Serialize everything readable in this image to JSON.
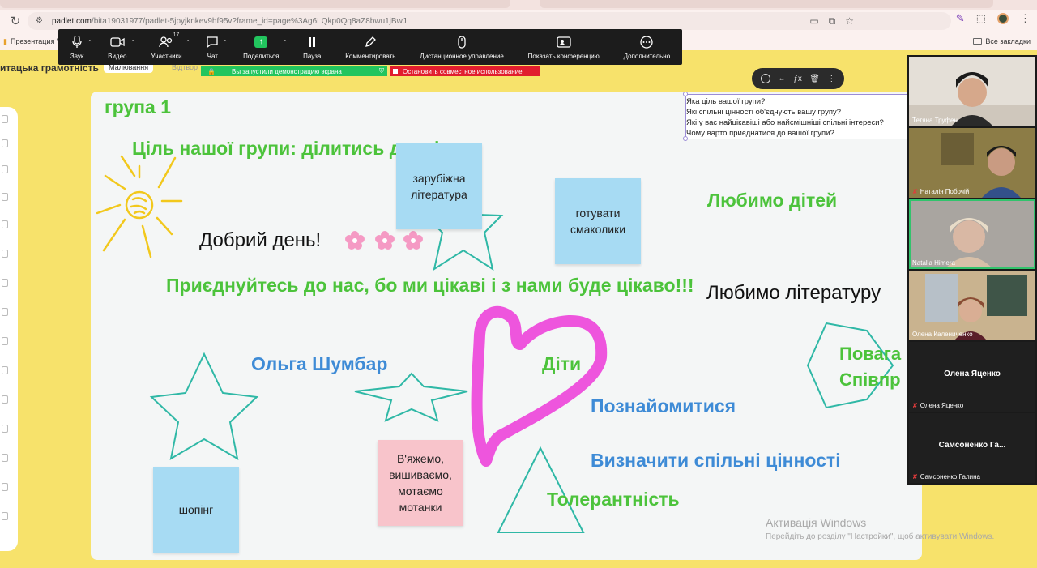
{
  "browser": {
    "url_domain": "padlet.com",
    "url_path": "/bita19031977/padlet-5jpyjknkev9hf95v?frame_id=page%3Ag6LQkp0Qq8aZ8bwu1jBwJ",
    "bookmark_left": "Презентация \"Г...",
    "bookmark_right": "Все закладки"
  },
  "padlet": {
    "title": "итацька грамотність",
    "mode_label": "Малювання",
    "mode_next": "Відтвор"
  },
  "zoom_toolbar": {
    "items": [
      {
        "label": "Звук"
      },
      {
        "label": "Видео"
      },
      {
        "label": "Участники",
        "badge": "17"
      },
      {
        "label": "Чат"
      },
      {
        "label": "Поделиться"
      },
      {
        "label": "Пауза"
      },
      {
        "label": "Комментировать"
      },
      {
        "label": "Дистанционное управление"
      },
      {
        "label": "Показать конференцию"
      },
      {
        "label": "Дополнительно"
      }
    ],
    "sharing_banner": "Вы запустили демонстрацию экрана",
    "stop_banner": "Остановить совместное использование"
  },
  "canvas": {
    "group_title": "група 1",
    "goal": "Ціль нашої групи: ділитись досвідом",
    "hello": "Добрий день!",
    "join": "Приєднуйтесь до нас, бо ми цікаві і з нами буде цікаво!!!",
    "love_kids": "Любимо дітей",
    "love_lit": "Любимо літературу",
    "olga": "Ольга Шумбар",
    "kids": "Діти",
    "meet": "Познайомитися",
    "values": "Визначити спільні цінності",
    "tolerance": "Толерантність",
    "respect_1": "Повага",
    "respect_2": "Співпр",
    "stickies": {
      "lit": "зарубіжна література",
      "cook": "готувати смаколики",
      "knit": "В'яжемо, вишиваємо, мотаємо мотанки",
      "shop": "шопінг"
    },
    "questions": [
      "Яка ціль вашої групи?",
      "Які спільні цінності об'єднують вашу групу?",
      "Які у вас найцікавіші або найсмішніші спільні інтереси?",
      "Чому варто приєднатися до вашої групи?"
    ],
    "colors": {
      "green": "#4cc33b",
      "blue": "#3e8bd6",
      "magenta": "#ee55dd",
      "teal": "#2fb8a6",
      "sun": "#f2c81c"
    }
  },
  "windows_watermark": {
    "line1": "Активація Windows",
    "line2": "Перейдіть до розділу \"Настройки\", щоб активувати Windows."
  },
  "participants": [
    {
      "name": "Тетяна Труфен",
      "muted": false
    },
    {
      "name": "Наталія Побочій",
      "muted": true
    },
    {
      "name": "Natalia Himera",
      "muted": false,
      "active": true
    },
    {
      "name": "Олена Калениченко",
      "muted": false
    },
    {
      "name": "Олена Яценко",
      "muted": true,
      "center": "Олена Яценко"
    },
    {
      "name": "Самсоненко Галина",
      "muted": true,
      "center": "Самсоненко Га..."
    }
  ]
}
